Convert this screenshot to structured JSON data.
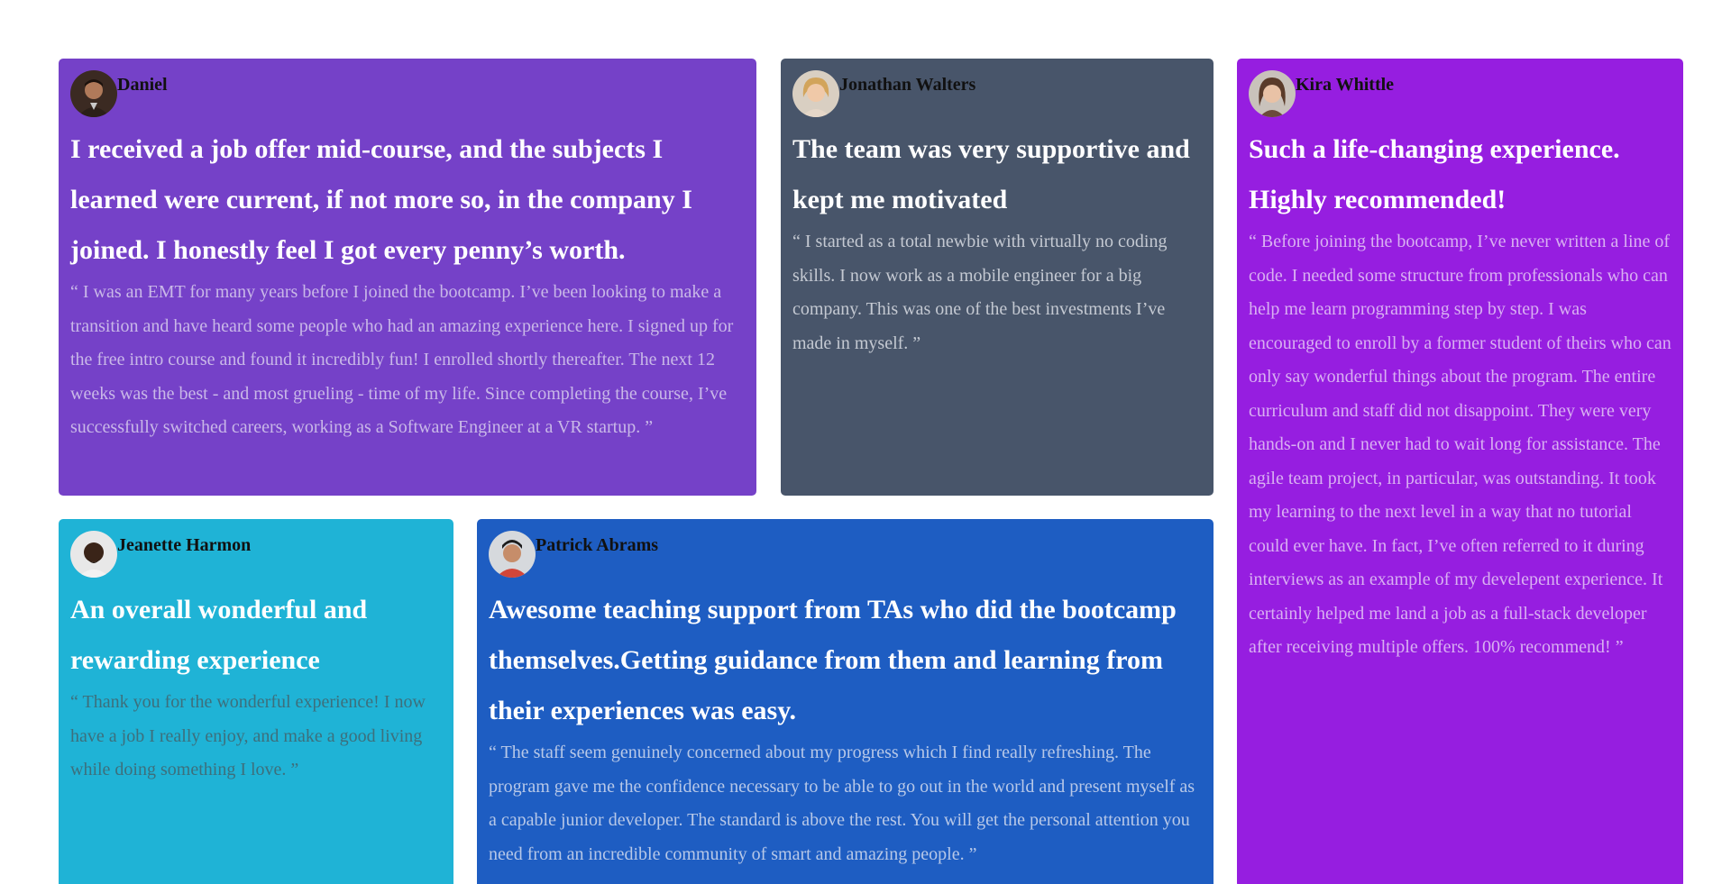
{
  "testimonials": [
    {
      "name": "Daniel",
      "headline": "I received a job offer mid-course, and the subjects I learned were current, if not more so, in the company I joined. I honestly feel I got every penny’s worth.",
      "quote": "“ I was an EMT for many years before I joined the bootcamp. I’ve been looking to make a transition and have heard some people who had an amazing experience here. I signed up for the free intro course and found it incredibly fun! I enrolled shortly thereafter. The next 12 weeks was the best - and most grueling - time of my life. Since completing the course, I’ve successfully switched careers, working as a Software Engineer at a VR startup. ”",
      "background": "#7541c8",
      "quote_color": "#c9b8e8"
    },
    {
      "name": "Jonathan Walters",
      "headline": "The team was very supportive and kept me motivated",
      "quote": "“ I started as a total newbie with virtually no coding skills. I now work as a mobile engineer for a big company. This was one of the best investments I’ve made in myself. ”",
      "background": "#48556a",
      "quote_color": "#c4c9d2"
    },
    {
      "name": "Kira Whittle",
      "headline": "Such a life-changing experience. Highly recommended!",
      "quote": "“ Before joining the bootcamp, I’ve never written a line of code. I needed some structure from professionals who can help me learn programming step by step. I was encouraged to enroll by a former student of theirs who can only say wonderful things about the program. The entire curriculum and staff did not disappoint. They were very hands-on and I never had to wait long for assistance. The agile team project, in particular, was outstanding. It took my learning to the next level in a way that no tutorial could ever have. In fact, I’ve often referred to it during interviews as an example of my develepent experience. It certainly helped me land a job as a full-stack developer after receiving multiple offers. 100% recommend! ”",
      "background": "#961ee0",
      "quote_color": "#d9b0f2"
    },
    {
      "name": "Jeanette Harmon",
      "headline": "An overall wonderful and rewarding experience",
      "quote": "“ Thank you for the wonderful experience! I now have a job I really enjoy, and make a good living while doing something I love. ”",
      "background": "#1fb3d6",
      "quote_color": "#3d6f7c"
    },
    {
      "name": "Patrick Abrams",
      "headline": "Awesome teaching support from TAs who did the bootcamp themselves.Getting guidance from them and learning from their experiences was easy.",
      "quote": "“ The staff seem genuinely concerned about my progress which I find really refreshing. The program gave me the confidence necessary to be able to go out in the world and present myself as a capable junior developer. The standard is above the rest. You will get the personal attention you need from an incredible community of smart and amazing people. ”",
      "background": "#1e5dc2",
      "quote_color": "#b7c8e8"
    }
  ],
  "icons": {
    "avatar": "avatar-photo-icon"
  }
}
